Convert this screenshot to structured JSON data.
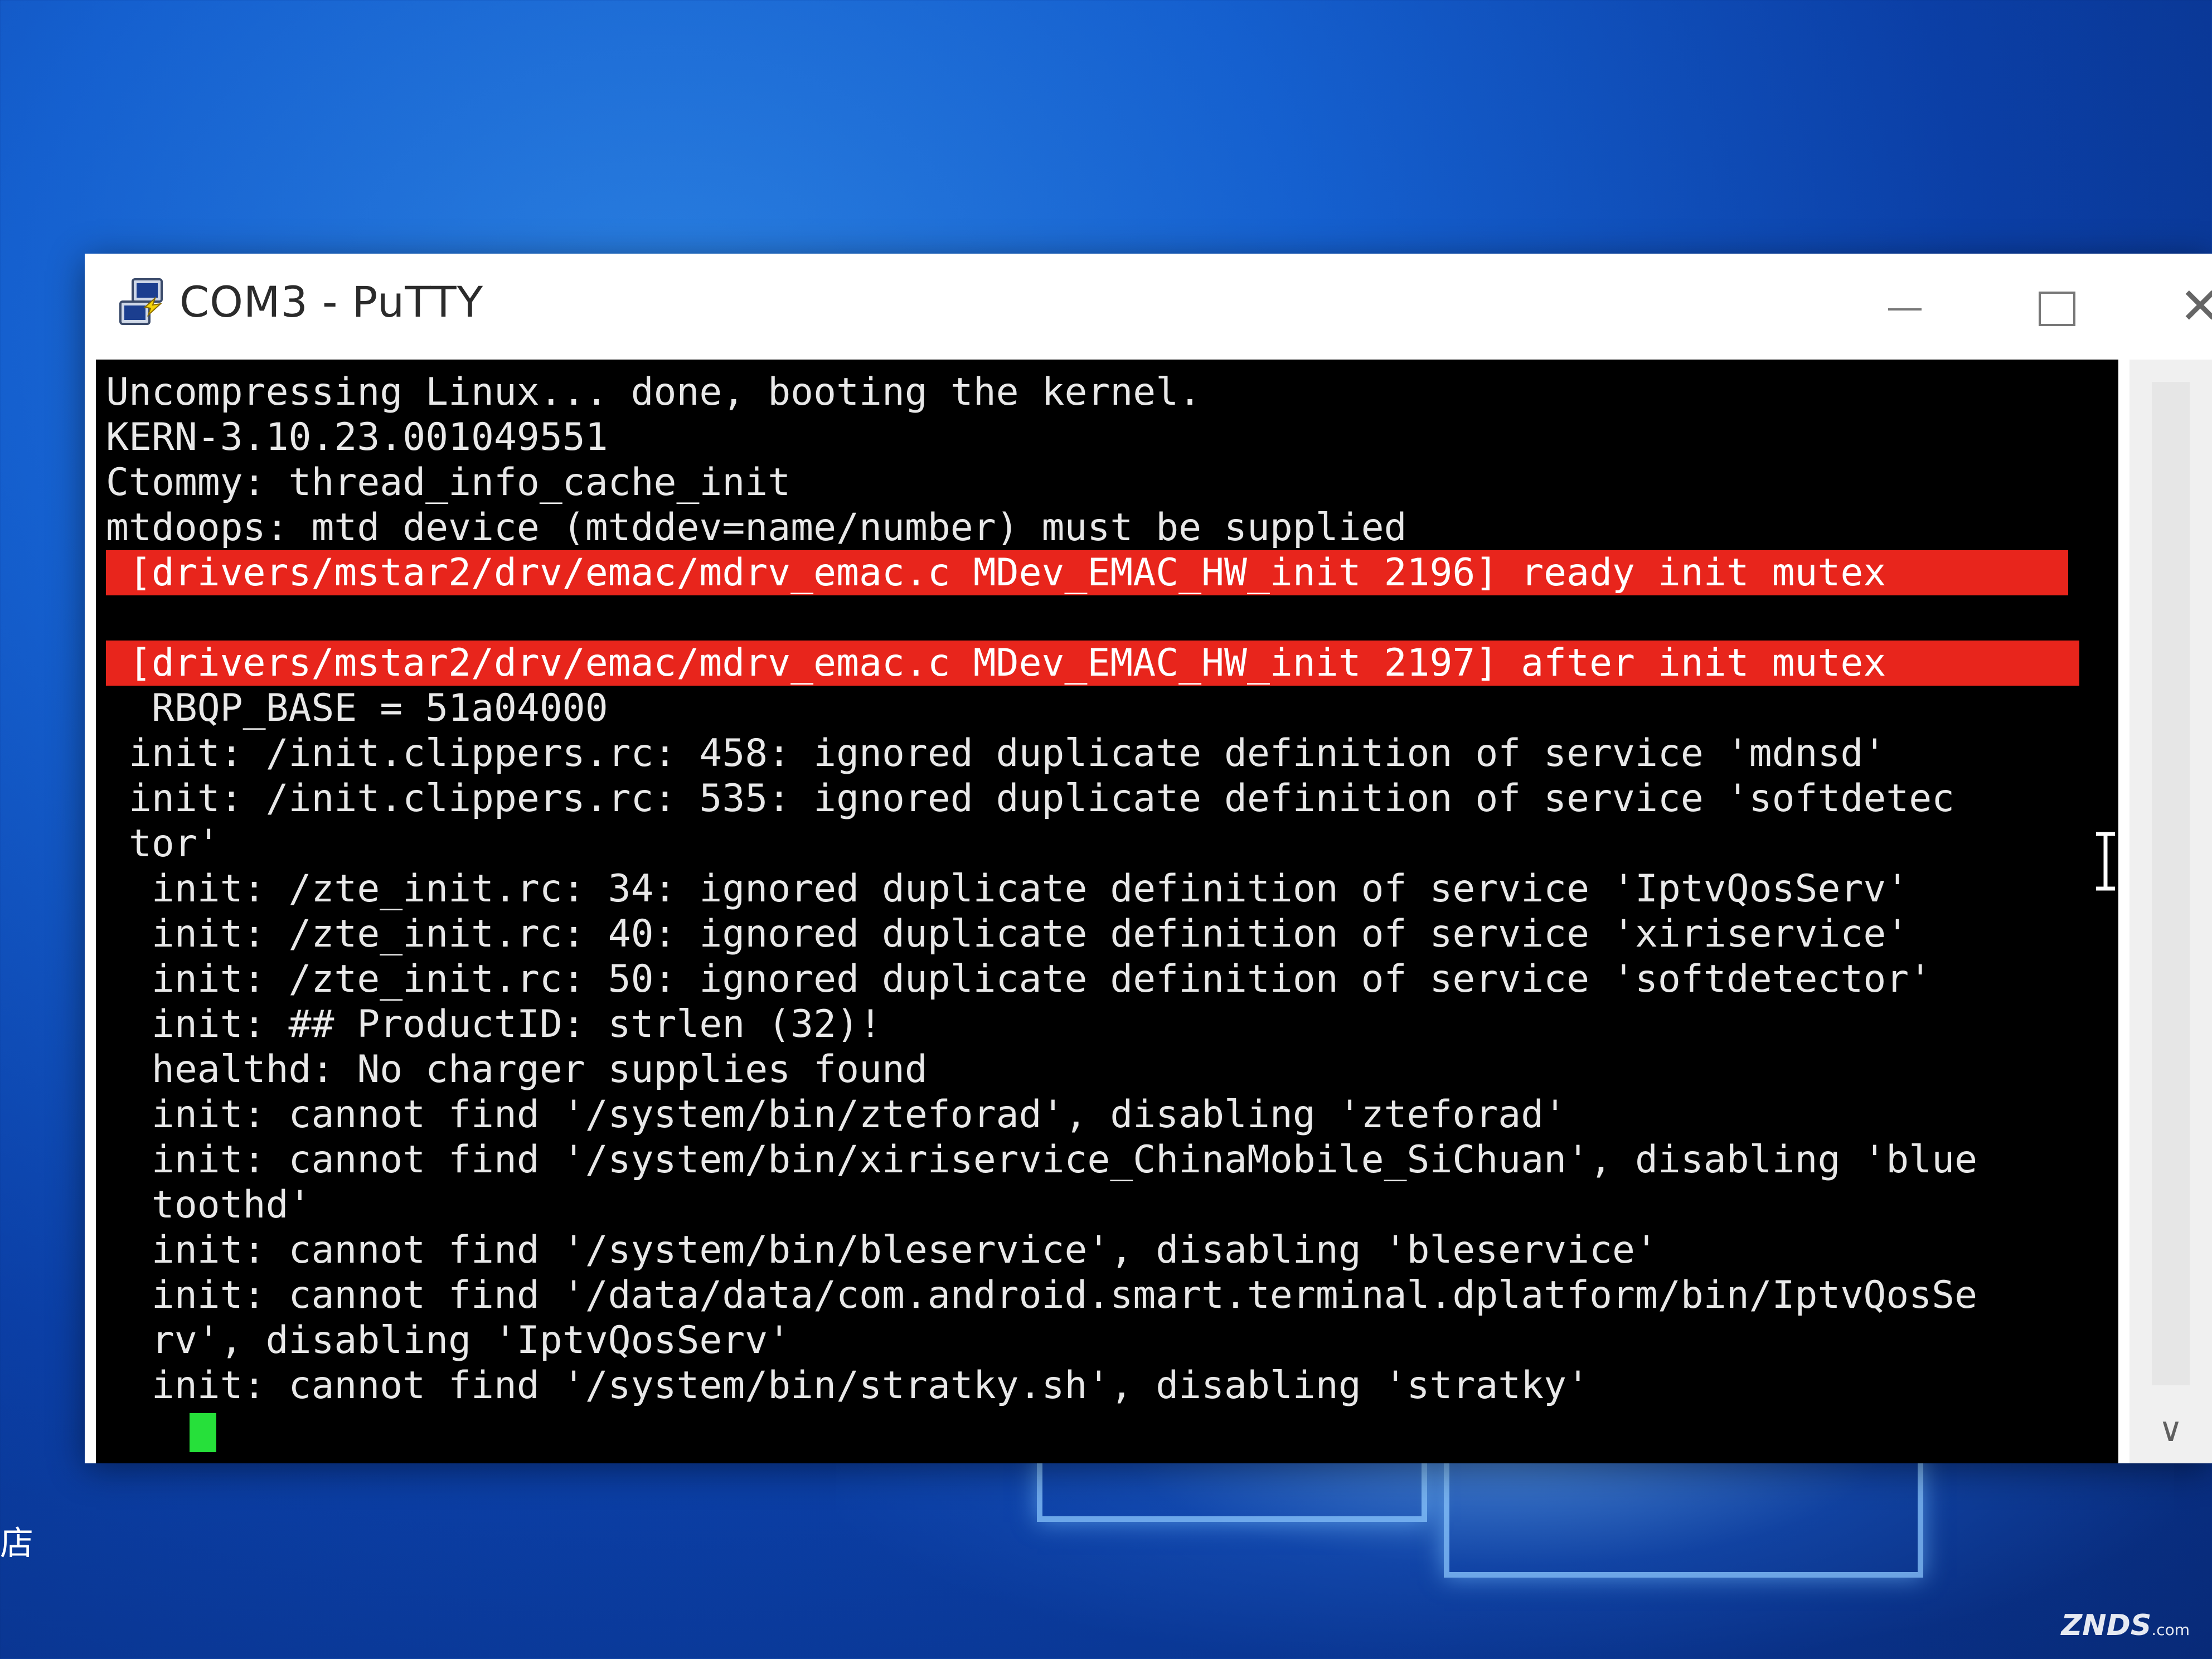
{
  "window": {
    "title": "COM3 - PuTTY",
    "icon": "putty-icon",
    "controls": {
      "minimize_icon": "minimize-icon",
      "maximize_icon": "maximize-icon",
      "close_label": "✕"
    }
  },
  "terminal": {
    "lines": [
      "Uncompressing Linux... done, booting the kernel.",
      "KERN-3.10.23.001049551",
      "Ctommy: thread_info_cache_init",
      "mtdoops: mtd device (mtddev=name/number) must be supplied",
      " [drivers/mstar2/drv/emac/mdrv_emac.c MDev_EMAC_HW_init 2196] ready init mutex",
      "",
      " [drivers/mstar2/drv/emac/mdrv_emac.c MDev_EMAC_HW_init 2197] after init mutex",
      "  RBQP_BASE = 51a04000",
      " init: /init.clippers.rc: 458: ignored duplicate definition of service 'mdnsd'",
      " init: /init.clippers.rc: 535: ignored duplicate definition of service 'softdetec",
      " tor'",
      "  init: /zte_init.rc: 34: ignored duplicate definition of service 'IptvQosServ'",
      "  init: /zte_init.rc: 40: ignored duplicate definition of service 'xiriservice'",
      "  init: /zte_init.rc: 50: ignored duplicate definition of service 'softdetector'",
      "  init: ## ProductID: strlen (32)!",
      "  healthd: No charger supplies found",
      "  init: cannot find '/system/bin/zteforad', disabling 'zteforad'",
      "  init: cannot find '/system/bin/xiriservice_ChinaMobile_SiChuan', disabling 'blue",
      "  toothd'",
      "  init: cannot find '/system/bin/bleservice', disabling 'bleservice'",
      "  init: cannot find '/data/data/com.android.smart.terminal.dplatform/bin/IptvQosSe",
      "  rv', disabling 'IptvQosServ'",
      "  init: cannot find '/system/bin/stratky.sh', disabling 'stratky'"
    ],
    "highlight_color": "#e8251c",
    "cursor_color": "#26e03a",
    "scroll_down_label": "∨"
  },
  "watermark": {
    "text": "ZNDS",
    "suffix": ".com"
  },
  "desktop": {
    "edge_char": "店"
  }
}
